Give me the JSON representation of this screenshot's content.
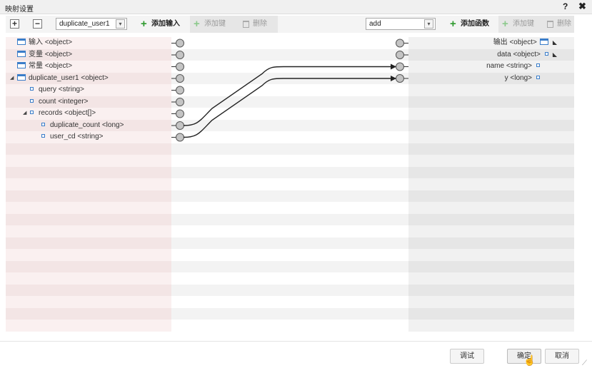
{
  "dialog": {
    "title": "映射设置",
    "help": "?",
    "close": "✖"
  },
  "toolbar": {
    "add_square": "+",
    "remove_square": "−",
    "input_select": "duplicate_user1",
    "add_input": "添加输入",
    "add_key_left": "添加键",
    "delete_left": "删除",
    "function_select": "add",
    "add_function": "添加函数",
    "add_key_right": "添加键",
    "delete_right": "删除",
    "dropdown_arrow": "▾"
  },
  "source_tree": [
    {
      "name": "输入",
      "type": "<object>",
      "icon": "object-icon",
      "depth": 0,
      "expander": ""
    },
    {
      "name": "变量",
      "type": "<object>",
      "icon": "object-icon",
      "depth": 0,
      "expander": ""
    },
    {
      "name": "常量",
      "type": "<object>",
      "icon": "object-icon",
      "depth": 0,
      "expander": ""
    },
    {
      "name": "duplicate_user1",
      "type": "<object>",
      "icon": "object-icon",
      "depth": 0,
      "expander": "◢"
    },
    {
      "name": "query",
      "type": "<string>",
      "icon": "field-icon",
      "depth": 1,
      "expander": ""
    },
    {
      "name": "count",
      "type": "<integer>",
      "icon": "field-icon",
      "depth": 1,
      "expander": ""
    },
    {
      "name": "records",
      "type": "<object[]>",
      "icon": "field-icon",
      "depth": 1,
      "expander": "◢"
    },
    {
      "name": "duplicate_count",
      "type": "<long>",
      "icon": "field-icon",
      "depth": 2,
      "expander": ""
    },
    {
      "name": "user_cd",
      "type": "<string>",
      "icon": "field-icon",
      "depth": 2,
      "expander": ""
    }
  ],
  "target_tree": [
    {
      "name": "输出",
      "type": "<object>",
      "icon": "object-icon",
      "expander": "◣"
    },
    {
      "name": "data",
      "type": "<object>",
      "icon": "field-icon",
      "expander": "◣"
    },
    {
      "name": "name",
      "type": "<string>",
      "icon": "field-icon",
      "expander": ""
    },
    {
      "name": "y",
      "type": "<long>",
      "icon": "field-icon",
      "expander": ""
    }
  ],
  "links": [
    {
      "from": "duplicate_count",
      "to": "name"
    },
    {
      "from": "user_cd",
      "to": "y"
    }
  ],
  "footer": {
    "debug": "调试",
    "confirm": "确定",
    "cancel": "取消"
  }
}
